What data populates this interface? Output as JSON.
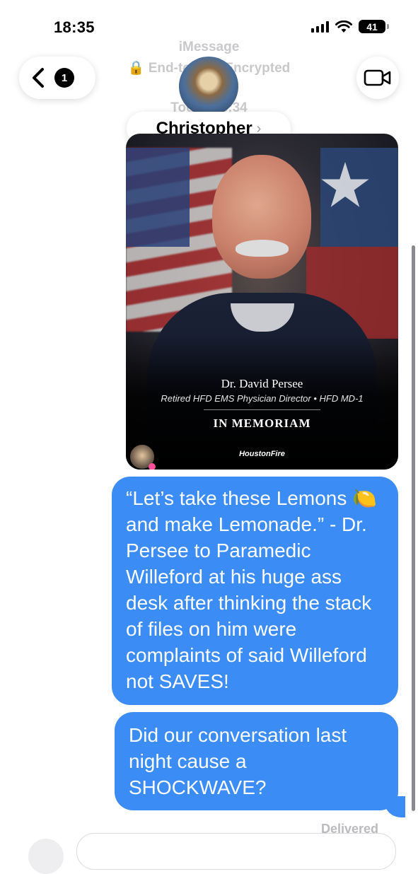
{
  "status_bar": {
    "time": "18:35",
    "battery": "41"
  },
  "header": {
    "service": "iMessage",
    "encrypted": "End-to-End Encrypted",
    "date": "Today 18:34",
    "back_badge": "1",
    "contact_name": "Christopher",
    "chevron": "›"
  },
  "image_card": {
    "name": "Dr. David Persee",
    "role": "Retired HFD EMS Physician Director • HFD MD-1",
    "memorial": "IN MEMORIAM",
    "logo": "HoustonFire"
  },
  "messages": [
    "“Let’s take these Lemons 🍋 and make Lemonade.” - Dr. Persee to Paramedic Willeford at his huge ass desk after thinking the stack of files on him were complaints of said Willeford not SAVES!",
    "Did our conversation last night cause a SHOCKWAVE?"
  ],
  "delivery_status": "Delivered",
  "colors": {
    "bubble_blue": "#3c8cf5"
  },
  "icons": [
    "back-chevron-icon",
    "video-camera-icon",
    "lock-icon",
    "signal-icon",
    "wifi-icon",
    "battery-icon",
    "plus-icon"
  ]
}
